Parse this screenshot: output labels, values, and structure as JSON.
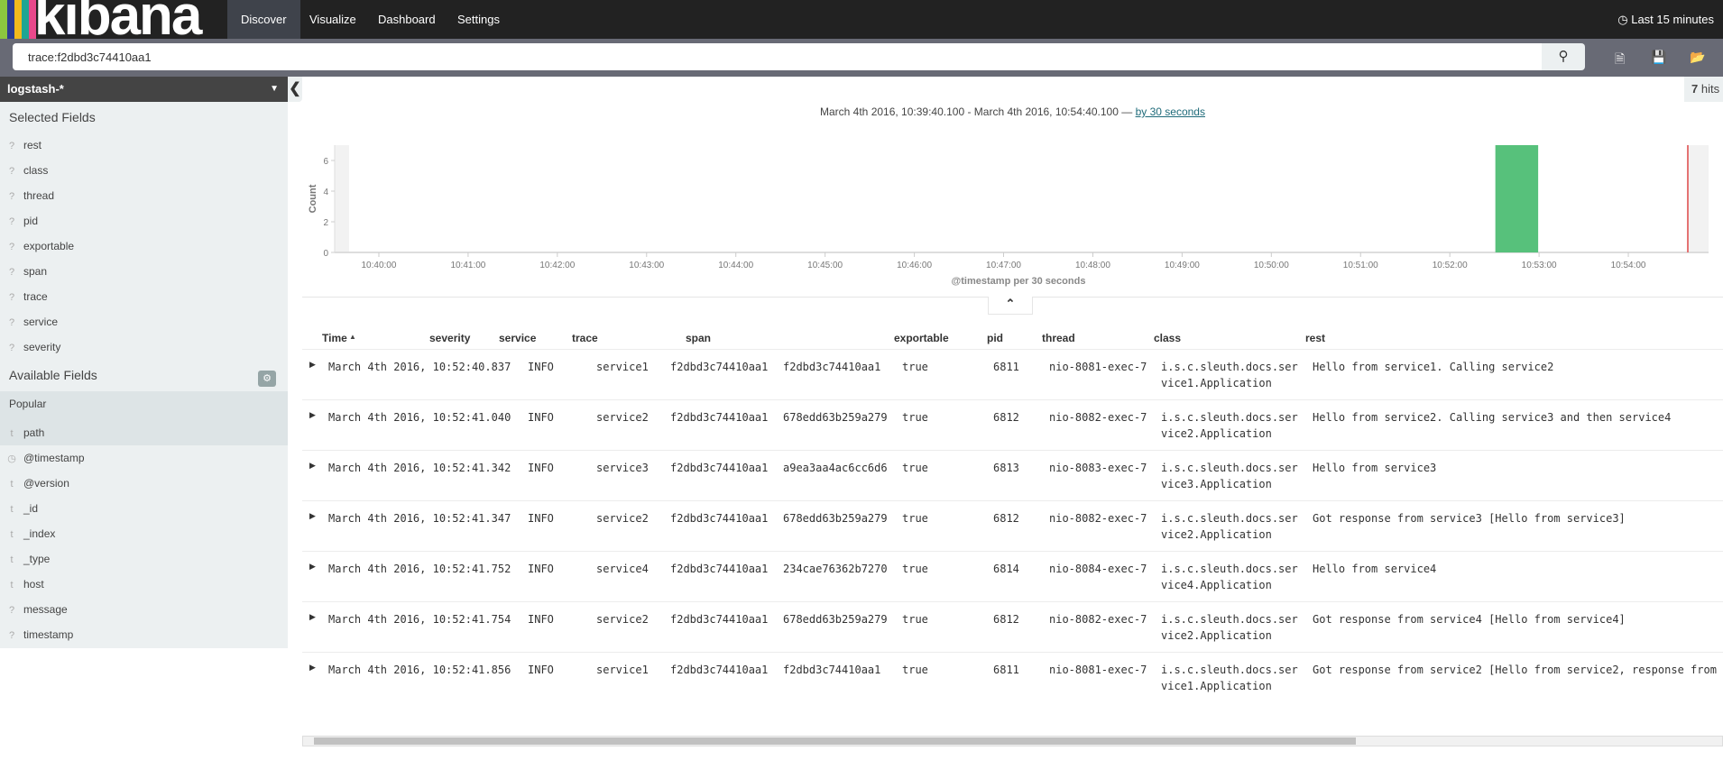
{
  "app": {
    "logo": "kibana",
    "logo_colors": [
      "#8cc63f",
      "#2d3c8e",
      "#f2b91d",
      "#1ea593",
      "#e8488b"
    ]
  },
  "nav": {
    "tabs": [
      {
        "label": "Discover",
        "active": true
      },
      {
        "label": "Visualize"
      },
      {
        "label": "Dashboard"
      },
      {
        "label": "Settings"
      }
    ],
    "time_picker": "Last 15 minutes"
  },
  "search": {
    "query": "trace:f2dbd3c74410aa1",
    "icons": [
      "search-icon",
      "new-document-icon",
      "save-icon",
      "open-folder-icon"
    ]
  },
  "sidebar": {
    "index_pattern": "logstash-*",
    "selected_title": "Selected Fields",
    "selected_fields": [
      {
        "type": "?",
        "name": "rest"
      },
      {
        "type": "?",
        "name": "class"
      },
      {
        "type": "?",
        "name": "thread"
      },
      {
        "type": "?",
        "name": "pid"
      },
      {
        "type": "?",
        "name": "exportable"
      },
      {
        "type": "?",
        "name": "span"
      },
      {
        "type": "?",
        "name": "trace"
      },
      {
        "type": "?",
        "name": "service"
      },
      {
        "type": "?",
        "name": "severity"
      }
    ],
    "available_title": "Available Fields",
    "popular_title": "Popular",
    "available_fields": [
      {
        "type": "t",
        "name": "path"
      },
      {
        "type": "clock",
        "name": "@timestamp"
      },
      {
        "type": "t",
        "name": "@version"
      },
      {
        "type": "t",
        "name": "_id"
      },
      {
        "type": "t",
        "name": "_index"
      },
      {
        "type": "t",
        "name": "_type"
      },
      {
        "type": "t",
        "name": "host"
      },
      {
        "type": "?",
        "name": "message"
      },
      {
        "type": "?",
        "name": "timestamp"
      }
    ]
  },
  "hits": {
    "count": "7",
    "label": "hits"
  },
  "range": {
    "text": "March 4th 2016, 10:39:40.100 - March 4th 2016, 10:54:40.100 —",
    "interval_link": "by 30 seconds"
  },
  "chart_data": {
    "type": "bar",
    "ylabel": "Count",
    "xlabel": "@timestamp per 30 seconds",
    "ylim": [
      0,
      7
    ],
    "yticks": [
      0,
      2,
      4,
      6
    ],
    "x_range": [
      "10:39:40",
      "10:54:40"
    ],
    "xticks": [
      "10:40:00",
      "10:41:00",
      "10:42:00",
      "10:43:00",
      "10:44:00",
      "10:45:00",
      "10:46:00",
      "10:47:00",
      "10:48:00",
      "10:49:00",
      "10:50:00",
      "10:51:00",
      "10:52:00",
      "10:53:00",
      "10:54:00"
    ],
    "bars": [
      {
        "x": "10:52:30",
        "value": 7
      }
    ],
    "bar_color": "#57c17b",
    "now_marker": "10:54:40",
    "now_color": "#e57373"
  },
  "table": {
    "headers": [
      "Time",
      "severity",
      "service",
      "trace",
      "span",
      "exportable",
      "pid",
      "thread",
      "class",
      "rest"
    ],
    "rows": [
      [
        "March 4th 2016, 10:52:40.837",
        "INFO",
        "service1",
        "f2dbd3c74410aa1",
        "f2dbd3c74410aa1",
        "true",
        "6811",
        "nio-8081-exec-7",
        "i.s.c.sleuth.docs.service1.Application",
        "Hello from service1. Calling service2"
      ],
      [
        "March 4th 2016, 10:52:41.040",
        "INFO",
        "service2",
        "f2dbd3c74410aa1",
        "678edd63b259a279",
        "true",
        "6812",
        "nio-8082-exec-7",
        "i.s.c.sleuth.docs.service2.Application",
        "Hello from service2. Calling service3 and then service4"
      ],
      [
        "March 4th 2016, 10:52:41.342",
        "INFO",
        "service3",
        "f2dbd3c74410aa1",
        "a9ea3aa4ac6cc6d6",
        "true",
        "6813",
        "nio-8083-exec-7",
        "i.s.c.sleuth.docs.service3.Application",
        "Hello from service3"
      ],
      [
        "March 4th 2016, 10:52:41.347",
        "INFO",
        "service2",
        "f2dbd3c74410aa1",
        "678edd63b259a279",
        "true",
        "6812",
        "nio-8082-exec-7",
        "i.s.c.sleuth.docs.service2.Application",
        "Got response from service3 [Hello from service3]"
      ],
      [
        "March 4th 2016, 10:52:41.752",
        "INFO",
        "service4",
        "f2dbd3c74410aa1",
        "234cae76362b7270",
        "true",
        "6814",
        "nio-8084-exec-7",
        "i.s.c.sleuth.docs.service4.Application",
        "Hello from service4"
      ],
      [
        "March 4th 2016, 10:52:41.754",
        "INFO",
        "service2",
        "f2dbd3c74410aa1",
        "678edd63b259a279",
        "true",
        "6812",
        "nio-8082-exec-7",
        "i.s.c.sleuth.docs.service2.Application",
        "Got response from service4 [Hello from service4]"
      ],
      [
        "March 4th 2016, 10:52:41.856",
        "INFO",
        "service1",
        "f2dbd3c74410aa1",
        "f2dbd3c74410aa1",
        "true",
        "6811",
        "nio-8081-exec-7",
        "i.s.c.sleuth.docs.service1.Application",
        "Got response from service2 [Hello from service2, response from"
      ]
    ]
  }
}
